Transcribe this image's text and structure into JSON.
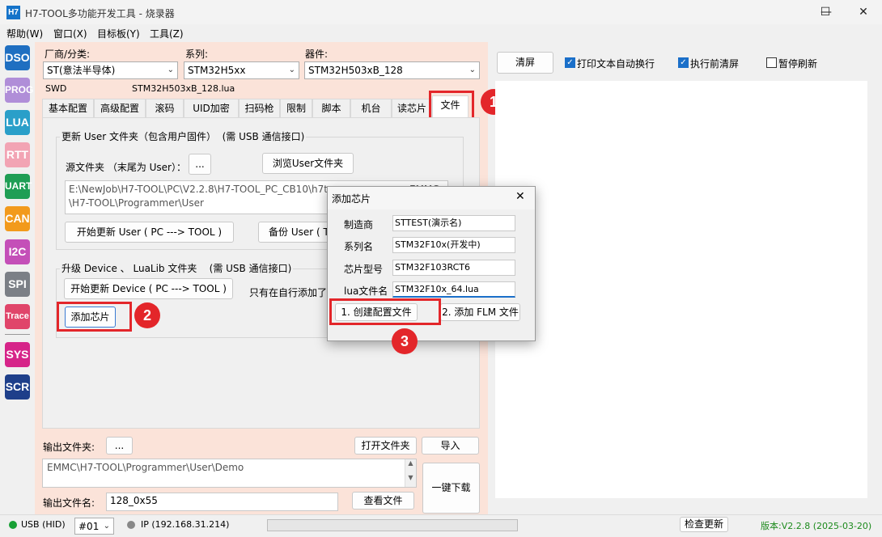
{
  "window": {
    "icon_text": "H7",
    "title": "H7-TOOL多功能开发工具 - 烧录器",
    "minimize": "—",
    "maximize": "☐",
    "close": "✕"
  },
  "menu": [
    "帮助(W)",
    "窗口(X)",
    "目标板(Y)",
    "工具(Z)"
  ],
  "sidebar": [
    {
      "label": "DSO",
      "color": "#1f6fc1"
    },
    {
      "label": "PROG",
      "color": "#b08ed8"
    },
    {
      "label": "LUA",
      "color": "#2a9fc9"
    },
    {
      "label": "RTT",
      "color": "#f2a4b4"
    },
    {
      "label": "UART",
      "color": "#1f9e55"
    },
    {
      "label": "CAN",
      "color": "#f29a1c"
    },
    {
      "label": "I2C",
      "color": "#c44fb8"
    },
    {
      "label": "SPI",
      "color": "#7b7f86"
    },
    {
      "label": "Trace",
      "color": "#e0456a"
    },
    {
      "label": "SYS",
      "color": "#d62489"
    },
    {
      "label": "SCR",
      "color": "#1e3f8a"
    }
  ],
  "selectors": {
    "vendor_label": "厂商/分类:",
    "vendor_value": "ST(意法半导体)",
    "series_label": "系列:",
    "series_value": "STM32H5xx",
    "device_label": "器件:",
    "device_value": "STM32H503xB_128"
  },
  "info": {
    "interface": "SWD",
    "lua_file": "STM32H503xB_128.lua"
  },
  "tabs": [
    "基本配置",
    "高级配置",
    "滚码",
    "UID加密",
    "扫码枪",
    "限制",
    "脚本",
    "机台",
    "读芯片",
    "文件"
  ],
  "file_tab": {
    "user_group_title": "更新 User 文件夹（包含用户固件）",
    "user_group_note": "(需 USB 通信接口)",
    "source_label": "源文件夹 （末尾为 User）：",
    "dots_button": "...",
    "browse_button": "浏览User文件夹",
    "path_line1": "E:\\NewJob\\H7-TOOL\\PC\\V2.2.8\\H7-TOOL_PC_CB10\\h7t",
    "path_line1_tail": "EMMC",
    "path_line2": "\\H7-TOOL\\Programmer\\User",
    "start_update_user": "开始更新 User ( PC ---> TOOL )",
    "backup_user": "备份 User ( T",
    "device_group_title": "升级 Device 、 LuaLib 文件夹",
    "device_group_note": "(需 USB 通信接口)",
    "start_update_device": "开始更新 Device ( PC ---> TOOL )",
    "only_note": "只有在自行添加了",
    "add_chip_button": "添加芯片"
  },
  "output": {
    "folder_label": "输出文件夹:",
    "folder_dots": "...",
    "open_folder": "打开文件夹",
    "import": "导入",
    "folder_path": "EMMC\\H7-TOOL\\Programmer\\User\\Demo",
    "filename_label": "输出文件名:",
    "filename_value": "128_0x55",
    "view_file": "查看文件",
    "one_click": "一键下载"
  },
  "right": {
    "clear_button": "清屏",
    "wrap_label": "打印文本自动换行",
    "wrap_checked": true,
    "clear_before_label": "执行前清屏",
    "clear_before_checked": true,
    "pause_label": "暂停刷新",
    "pause_checked": false
  },
  "dialog": {
    "title": "添加芯片",
    "close": "✕",
    "fields": [
      {
        "label": "制造商",
        "value": "STTEST(演示名)"
      },
      {
        "label": "系列名",
        "value": "STM32F10x(开发中)"
      },
      {
        "label": "芯片型号",
        "value": "STM32F103RCT6"
      },
      {
        "label": "lua文件名",
        "value": "STM32F10x_64.lua"
      }
    ],
    "create_button": "1. 创建配置文件",
    "add_flm_button": "2. 添加 FLM 文件"
  },
  "annotations": [
    "1",
    "2",
    "3"
  ],
  "statusbar": {
    "usb": "USB (HID)",
    "port": "#01",
    "ip": "IP (192.168.31.214)",
    "check_update": "检查更新",
    "version": "版本:V2.2.8 (2025-03-20)"
  }
}
